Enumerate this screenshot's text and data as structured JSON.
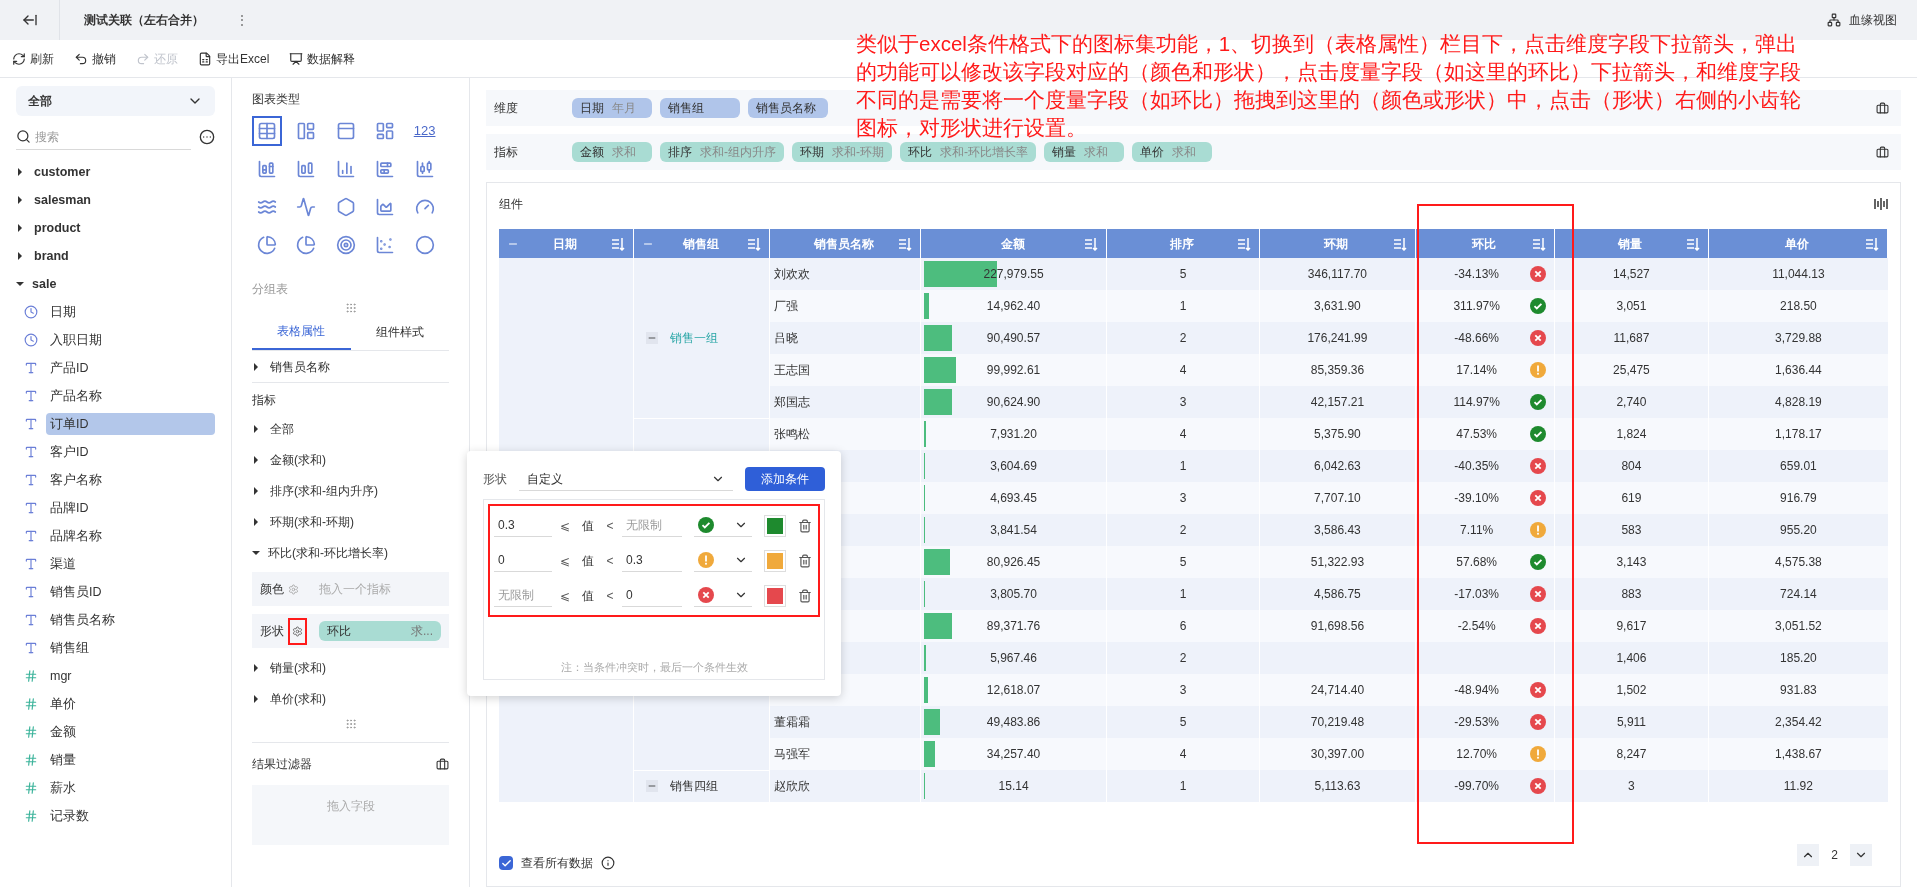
{
  "header": {
    "title": "测试关联（左右合并）",
    "more": "⋮",
    "lineage": "血缘视图"
  },
  "toolbar": [
    {
      "label": "刷新",
      "kind": "refresh",
      "disabled": false
    },
    {
      "label": "撤销",
      "kind": "undo",
      "disabled": false
    },
    {
      "label": "还原",
      "kind": "redo",
      "disabled": true
    },
    {
      "label": "导出Excel",
      "kind": "excel",
      "disabled": false
    },
    {
      "label": "数据解释",
      "kind": "explain",
      "disabled": false
    }
  ],
  "fields": {
    "scope": "全部",
    "search_placeholder": "搜索",
    "tables": [
      {
        "name": "customer",
        "expanded": false
      },
      {
        "name": "salesman",
        "expanded": false
      },
      {
        "name": "product",
        "expanded": false
      },
      {
        "name": "brand",
        "expanded": false
      },
      {
        "name": "sale",
        "expanded": true,
        "children": [
          {
            "name": "日期",
            "kind": "date",
            "selected": false
          },
          {
            "name": "入职日期",
            "kind": "date",
            "selected": false
          },
          {
            "name": "产品ID",
            "kind": "text",
            "selected": false
          },
          {
            "name": "产品名称",
            "kind": "text",
            "selected": false
          },
          {
            "name": "订单ID",
            "kind": "text",
            "selected": true
          },
          {
            "name": "客户ID",
            "kind": "text",
            "selected": false
          },
          {
            "name": "客户名称",
            "kind": "text",
            "selected": false
          },
          {
            "name": "品牌ID",
            "kind": "text",
            "selected": false
          },
          {
            "name": "品牌名称",
            "kind": "text",
            "selected": false
          },
          {
            "name": "渠道",
            "kind": "text",
            "selected": false
          },
          {
            "name": "销售员ID",
            "kind": "text",
            "selected": false
          },
          {
            "name": "销售员名称",
            "kind": "text",
            "selected": false
          },
          {
            "name": "销售组",
            "kind": "text",
            "selected": false
          },
          {
            "name": "mgr",
            "kind": "number",
            "selected": false
          },
          {
            "name": "单价",
            "kind": "number",
            "selected": false
          },
          {
            "name": "金额",
            "kind": "number",
            "selected": false
          },
          {
            "name": "销量",
            "kind": "number",
            "selected": false
          },
          {
            "name": "薪水",
            "kind": "number",
            "selected": false
          },
          {
            "name": "记录数",
            "kind": "count",
            "selected": false
          }
        ]
      }
    ]
  },
  "config": {
    "chart_type_title": "图表类型",
    "chart_types": [
      {
        "kind": "table",
        "selected": true
      },
      {
        "kind": "cross",
        "selected": false
      },
      {
        "kind": "list",
        "selected": false
      },
      {
        "kind": "card",
        "selected": false
      },
      {
        "kind": "number",
        "label": "123",
        "selected": false
      },
      {
        "kind": "stacked-column",
        "selected": false
      },
      {
        "kind": "grouped-column",
        "selected": false
      },
      {
        "kind": "column",
        "selected": false
      },
      {
        "kind": "stacked-bar",
        "selected": false
      },
      {
        "kind": "waterfall",
        "selected": false
      },
      {
        "kind": "wave",
        "selected": false
      },
      {
        "kind": "line",
        "selected": false
      },
      {
        "kind": "radar",
        "selected": false
      },
      {
        "kind": "area",
        "selected": false
      },
      {
        "kind": "gauge",
        "selected": false
      },
      {
        "kind": "pie",
        "selected": false
      },
      {
        "kind": "rose",
        "selected": false
      },
      {
        "kind": "ring",
        "selected": false
      },
      {
        "kind": "scatter",
        "selected": false
      },
      {
        "kind": "bubble",
        "selected": false
      }
    ],
    "chart_name": "分组表",
    "tabs": [
      {
        "label": "表格属性",
        "selected": true
      },
      {
        "label": "组件样式",
        "selected": false
      }
    ],
    "dimension_items": [
      {
        "label": "销售员名称",
        "expanded": false
      }
    ],
    "metrics_title": "指标",
    "metric_items": [
      {
        "label": "全部",
        "expanded": false
      },
      {
        "label": "金额(求和)",
        "expanded": false
      },
      {
        "label": "排序(求和-组内升序)",
        "expanded": false
      },
      {
        "label": "环期(求和-环期)",
        "expanded": false
      },
      {
        "label": "环比(求和-环比增长率)",
        "expanded": true,
        "color": {
          "label": "颜色",
          "placeholder": "拖入一个指标"
        },
        "shape": {
          "label": "形状",
          "field": "环比",
          "agg": "求..."
        }
      },
      {
        "label": "销量(求和)",
        "expanded": false
      },
      {
        "label": "单价(求和)",
        "expanded": false
      }
    ],
    "filter": {
      "title": "结果过滤器",
      "placeholder": "拖入字段"
    }
  },
  "shelves": [
    {
      "label": "维度",
      "kind": "dimension",
      "chips": [
        {
          "name": "日期",
          "agg": "年月"
        },
        {
          "name": "销售组"
        },
        {
          "name": "销售员名称"
        }
      ]
    },
    {
      "label": "指标",
      "kind": "measure",
      "chips": [
        {
          "name": "金额",
          "agg": "求和"
        },
        {
          "name": "排序",
          "agg": "求和-组内升序"
        },
        {
          "name": "环期",
          "agg": "求和-环期"
        },
        {
          "name": "环比",
          "agg": "求和-环比增长率"
        },
        {
          "name": "销量",
          "agg": "求和"
        },
        {
          "name": "单价",
          "agg": "求和"
        }
      ]
    }
  ],
  "table": {
    "title": "组件",
    "columns": [
      {
        "label": "日期",
        "collapsible": true
      },
      {
        "label": "销售组",
        "collapsible": true
      },
      {
        "label": "销售员名称",
        "collapsible": false
      },
      {
        "label": "金额",
        "collapsible": false
      },
      {
        "label": "排序",
        "collapsible": false
      },
      {
        "label": "环期",
        "collapsible": false
      },
      {
        "label": "环比",
        "collapsible": false
      },
      {
        "label": "销量",
        "collapsible": false
      },
      {
        "label": "单价",
        "collapsible": false
      }
    ],
    "groups": [
      {
        "label": "销售一组",
        "expanded": true,
        "rows": [
          {
            "name": "刘欢欢",
            "amount": "227,979.55",
            "level": 0.41,
            "rank": "5",
            "prev": "346,117.70",
            "ratio": "-34.13%",
            "kind": "bad",
            "qty": "14,527",
            "price": "11,044.13"
          },
          {
            "name": "厂强",
            "amount": "14,962.40",
            "level": 0.027,
            "rank": "1",
            "prev": "3,631.90",
            "ratio": "311.97%",
            "kind": "good",
            "qty": "3,051",
            "price": "218.50"
          },
          {
            "name": "吕晓",
            "amount": "90,490.57",
            "level": 0.16,
            "rank": "2",
            "prev": "176,241.99",
            "ratio": "-48.66%",
            "kind": "bad",
            "qty": "11,687",
            "price": "3,729.88"
          },
          {
            "name": "王志国",
            "amount": "99,992.61",
            "level": 0.18,
            "rank": "4",
            "prev": "85,359.36",
            "ratio": "17.14%",
            "kind": "warn",
            "qty": "25,475",
            "price": "1,636.44"
          },
          {
            "name": "郑国志",
            "amount": "90,624.90",
            "level": 0.16,
            "rank": "3",
            "prev": "42,157.21",
            "ratio": "114.97%",
            "kind": "good",
            "qty": "2,740",
            "price": "4,828.19"
          }
        ]
      },
      {
        "rows": [
          {
            "name": "张鸣松",
            "amount": "7,931.20",
            "level": 0.014,
            "rank": "4",
            "prev": "5,375.90",
            "ratio": "47.53%",
            "kind": "good",
            "qty": "1,824",
            "price": "1,178.17"
          },
          {
            "amount": "3,604.69",
            "level": 0.006,
            "rank": "1",
            "prev": "6,042.63",
            "ratio": "-40.35%",
            "kind": "bad",
            "qty": "804",
            "price": "659.01"
          },
          {
            "amount": "4,693.45",
            "level": 0.008,
            "rank": "3",
            "prev": "7,707.10",
            "ratio": "-39.10%",
            "kind": "bad",
            "qty": "619",
            "price": "916.79"
          },
          {
            "amount": "3,841.54",
            "level": 0.007,
            "rank": "2",
            "prev": "3,586.43",
            "ratio": "7.11%",
            "kind": "warn",
            "qty": "583",
            "price": "955.20"
          },
          {
            "amount": "80,926.45",
            "level": 0.145,
            "rank": "5",
            "prev": "51,322.93",
            "ratio": "57.68%",
            "kind": "good",
            "qty": "3,143",
            "price": "4,575.38"
          },
          {
            "amount": "3,805.70",
            "level": 0.007,
            "rank": "1",
            "prev": "4,586.75",
            "ratio": "-17.03%",
            "kind": "bad",
            "qty": "883",
            "price": "724.14"
          },
          {
            "amount": "89,371.76",
            "level": 0.16,
            "rank": "6",
            "prev": "91,698.56",
            "ratio": "-2.54%",
            "kind": "bad",
            "qty": "9,617",
            "price": "3,051.52"
          },
          {
            "amount": "5,967.46",
            "level": 0.01,
            "rank": "2",
            "qty": "1,406",
            "price": "185.20"
          },
          {
            "amount": "12,618.07",
            "level": 0.022,
            "rank": "3",
            "prev": "24,714.40",
            "ratio": "-48.94%",
            "kind": "bad",
            "qty": "1,502",
            "price": "931.83"
          },
          {
            "name": "董霜霜",
            "amount": "49,483.86",
            "level": 0.088,
            "rank": "5",
            "prev": "70,219.48",
            "ratio": "-29.53%",
            "kind": "bad",
            "qty": "5,911",
            "price": "2,354.42"
          },
          {
            "name": "马强军",
            "amount": "34,257.40",
            "level": 0.062,
            "rank": "4",
            "prev": "30,397.00",
            "ratio": "12.70%",
            "kind": "warn",
            "qty": "8,247",
            "price": "1,438.67"
          }
        ]
      },
      {
        "label": "销售四组",
        "expanded": true,
        "rows": [
          {
            "name": "赵欣欣",
            "amount": "15.14",
            "level": 0.006,
            "rank": "1",
            "prev": "5,113.63",
            "ratio": "-99.70%",
            "kind": "bad",
            "qty": "3",
            "price": "11.92"
          }
        ]
      }
    ]
  },
  "footer": {
    "show_all": {
      "label": "查看所有数据",
      "checked": true
    },
    "page": "2"
  },
  "popup": {
    "shape_label": "形状",
    "shape_value": "自定义",
    "add_button": "添加条件",
    "conditions": [
      {
        "min": "0.3",
        "op_low": "⩽",
        "value_label": "值",
        "op_high": "<",
        "max_placeholder": "无限制",
        "kind": "good",
        "color": "#1e8a2e"
      },
      {
        "min": "0",
        "op_low": "⩽",
        "value_label": "值",
        "op_high": "<",
        "max": "0.3",
        "kind": "warn",
        "color": "#f0a93b"
      },
      {
        "min_placeholder": "无限制",
        "op_low": "⩽",
        "value_label": "值",
        "op_high": "<",
        "max": "0",
        "kind": "bad",
        "color": "#e5484d"
      }
    ],
    "note": "注：当条件冲突时，最后一个条件生效"
  },
  "annotation": {
    "text": "类似于excel条件格式下的图标集功能，1、切换到（表格属性）栏目下，点击维度字段下拉箭头，弹出的功能可以修改该字段对应的（颜色和形状），点击度量字段（如这里的环比）下拉箭头，和维度字段不同的是需要将一个度量字段（如环比）拖拽到这里的（颜色或形状）中，点击（形状）右侧的小齿轮图标，对形状进行设置。"
  }
}
